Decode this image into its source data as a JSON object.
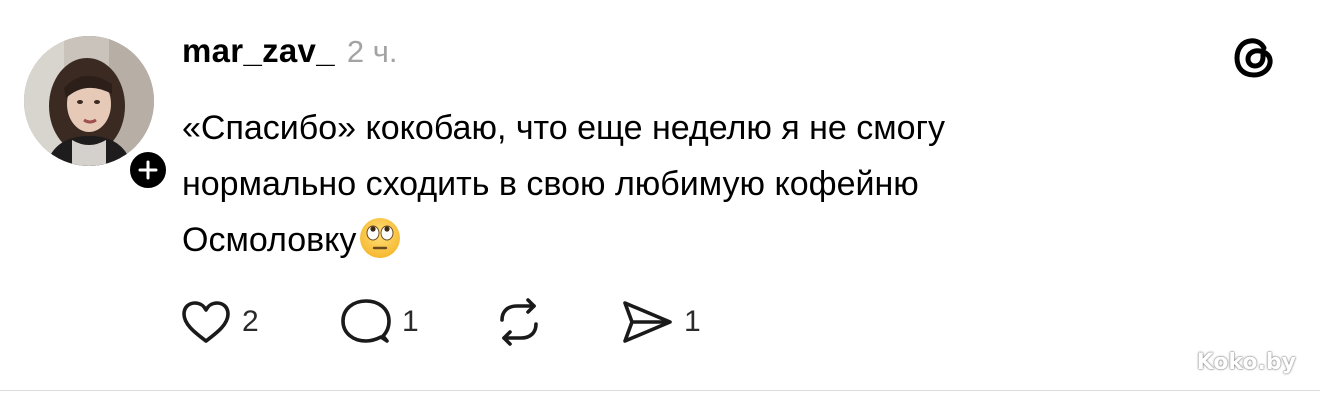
{
  "post": {
    "username": "mar_zav_",
    "timestamp": "2 ч.",
    "text_lines": [
      "«Спасибо» кокобаю, что еще неделю я не смогу",
      "нормально сходить в свою любимую кофейню",
      "Осмоловку"
    ],
    "emoji": "face-with-rolling-eyes",
    "avatar_icon": "profile-photo",
    "follow_icon": "plus-icon"
  },
  "actions": {
    "like": {
      "icon": "heart-icon",
      "count": "2"
    },
    "comment": {
      "icon": "comment-bubble-icon",
      "count": "1"
    },
    "repost": {
      "icon": "repost-icon",
      "count": ""
    },
    "share": {
      "icon": "send-icon",
      "count": "1"
    }
  },
  "branding": {
    "app_icon": "threads-logo-icon",
    "watermark": "Koko.by"
  },
  "colors": {
    "text": "#000000",
    "muted": "#a3a3a3",
    "badge": "#000000"
  }
}
